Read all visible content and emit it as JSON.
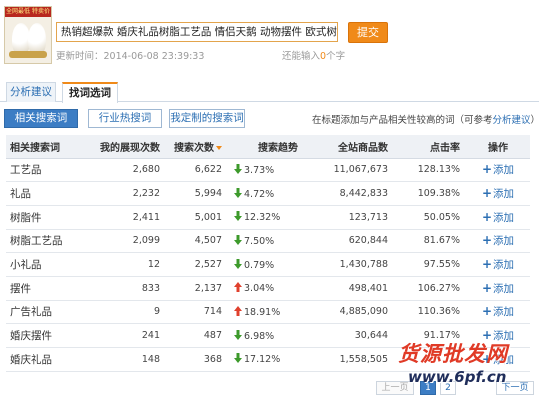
{
  "product": {
    "thumbnail_banner": "全网最低 特卖价",
    "title": "热销超爆款 婚庆礼品树脂工艺品 情侣天鹅 动物摆件 欧式树脂摆件",
    "submit_label": "提交",
    "update_time": "更新时间：2014-06-08 23:39:33",
    "remain_prefix": "还能输入",
    "remain_count": "0",
    "remain_suffix": "个字"
  },
  "tabs": [
    {
      "label": "分析建议",
      "active": false
    },
    {
      "label": "找词选词",
      "active": true
    }
  ],
  "subtabs": [
    {
      "label": "相关搜索词",
      "active": true
    },
    {
      "label": "行业热搜词",
      "active": false
    },
    {
      "label": "我定制的搜索词",
      "active": false
    }
  ],
  "hint": {
    "text": "在标题添加与产品相关性较高的词（可参考",
    "link": "分析建议",
    "suffix": "）"
  },
  "table": {
    "headers": [
      "相关搜索词",
      "我的展现次数",
      "搜索次数",
      "搜索趋势",
      "全站商品数",
      "点击率",
      "操作"
    ],
    "sort_column": 2,
    "rows": [
      {
        "term": "工艺品",
        "impressions": "2,680",
        "searches": "6,622",
        "trend": "3.73%",
        "trend_dir": "down",
        "products": "11,067,673",
        "ctr": "128.13%",
        "action": "添加"
      },
      {
        "term": "礼品",
        "impressions": "2,232",
        "searches": "5,994",
        "trend": "4.72%",
        "trend_dir": "down",
        "products": "8,442,833",
        "ctr": "109.38%",
        "action": "添加"
      },
      {
        "term": "树脂件",
        "impressions": "2,411",
        "searches": "5,001",
        "trend": "12.32%",
        "trend_dir": "down",
        "products": "123,713",
        "ctr": "50.05%",
        "action": "添加"
      },
      {
        "term": "树脂工艺品",
        "impressions": "2,099",
        "searches": "4,507",
        "trend": "7.50%",
        "trend_dir": "down",
        "products": "620,844",
        "ctr": "81.67%",
        "action": "添加"
      },
      {
        "term": "小礼品",
        "impressions": "12",
        "searches": "2,527",
        "trend": "0.79%",
        "trend_dir": "down",
        "products": "1,430,788",
        "ctr": "97.55%",
        "action": "添加"
      },
      {
        "term": "摆件",
        "impressions": "833",
        "searches": "2,137",
        "trend": "3.04%",
        "trend_dir": "up",
        "products": "498,401",
        "ctr": "106.27%",
        "action": "添加"
      },
      {
        "term": "广告礼品",
        "impressions": "9",
        "searches": "714",
        "trend": "18.91%",
        "trend_dir": "up",
        "products": "4,885,090",
        "ctr": "110.36%",
        "action": "添加"
      },
      {
        "term": "婚庆摆件",
        "impressions": "241",
        "searches": "487",
        "trend": "6.98%",
        "trend_dir": "down",
        "products": "30,644",
        "ctr": "91.17%",
        "action": "添加"
      },
      {
        "term": "婚庆礼品",
        "impressions": "148",
        "searches": "368",
        "trend": "17.12%",
        "trend_dir": "down",
        "products": "1,558,505",
        "ctr": "",
        "action": "添加"
      }
    ]
  },
  "pagination": {
    "prev": "上一页",
    "pages": [
      "1",
      "2"
    ],
    "current": "1",
    "next": "下一页"
  },
  "watermark": {
    "text": "货源批发网",
    "url": "www.6pf.cn"
  },
  "colors": {
    "accent": "#f08a19",
    "link": "#2c6fb3",
    "trend_down": "#3d9a2b",
    "trend_up": "#e0402d"
  }
}
